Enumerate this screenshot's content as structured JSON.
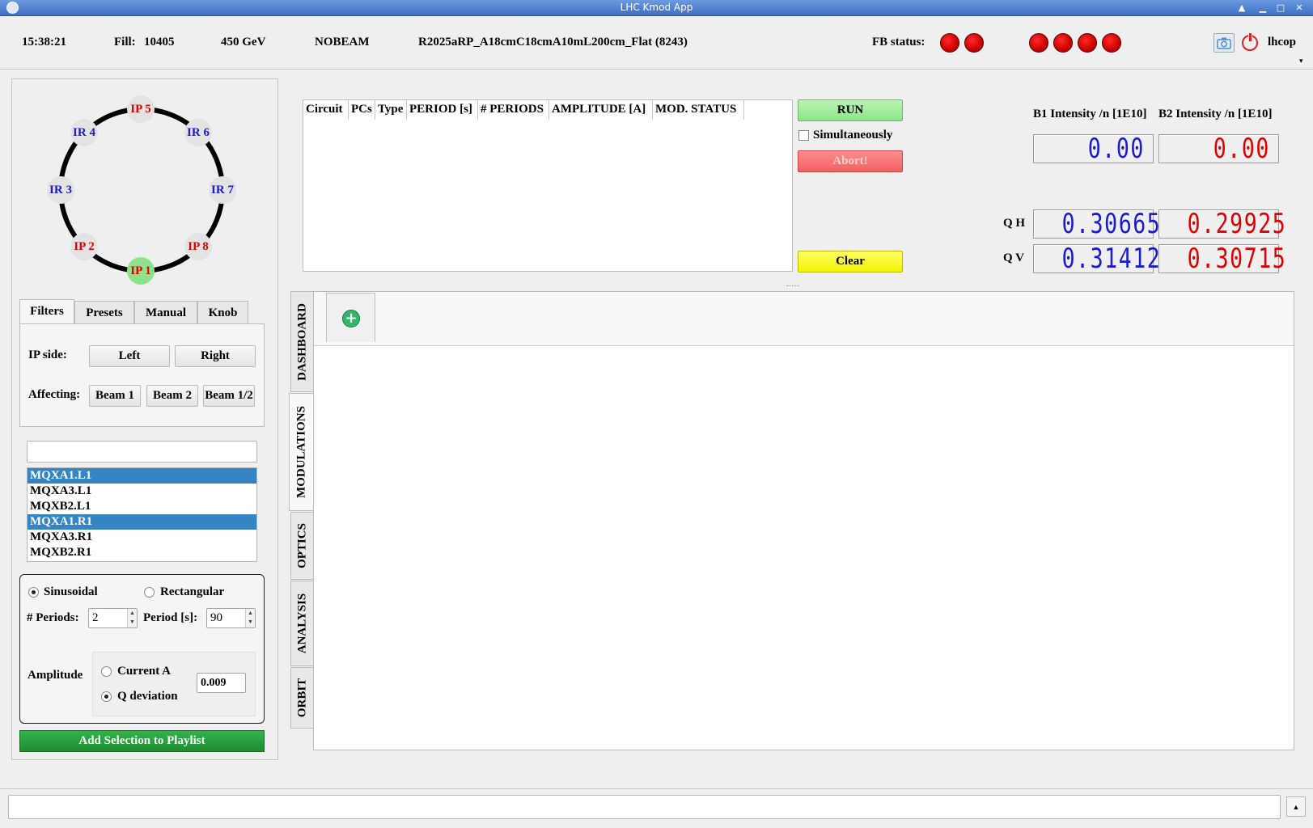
{
  "window": {
    "title": "LHC Kmod App"
  },
  "topbar": {
    "time": "15:38:21",
    "fill_label": "Fill:",
    "fill_number": "10405",
    "energy": "450 GeV",
    "beam_mode": "NOBEAM",
    "optics": "R2025aRP_A18cmC18cmA10mL200cm_Flat (8243)",
    "fb_status_label": "FB status:",
    "user": "lhcop",
    "led_color": "#e00000"
  },
  "ring": {
    "nodes": [
      {
        "label": "IP 5",
        "color": "red"
      },
      {
        "label": "IR 4",
        "color": "blue"
      },
      {
        "label": "IR 6",
        "color": "blue"
      },
      {
        "label": "IR 3",
        "color": "blue"
      },
      {
        "label": "IR 7",
        "color": "blue"
      },
      {
        "label": "IP 2",
        "color": "red"
      },
      {
        "label": "IP 8",
        "color": "red"
      },
      {
        "label": "IP 1",
        "color": "red",
        "selected": true
      }
    ]
  },
  "left_tabs": [
    "Filters",
    "Presets",
    "Manual",
    "Knob"
  ],
  "filters": {
    "ip_side_label": "IP side:",
    "left": "Left",
    "right": "Right",
    "affecting_label": "Affecting:",
    "beam1": "Beam 1",
    "beam2": "Beam 2",
    "beam12": "Beam 1/2"
  },
  "search": {
    "value": ""
  },
  "circuits": [
    {
      "name": "MQXA1.L1",
      "selected": true
    },
    {
      "name": "MQXA3.L1",
      "selected": false
    },
    {
      "name": "MQXB2.L1",
      "selected": false
    },
    {
      "name": "MQXA1.R1",
      "selected": true
    },
    {
      "name": "MQXA3.R1",
      "selected": false
    },
    {
      "name": "MQXB2.R1",
      "selected": false
    }
  ],
  "modulation": {
    "sinusoidal": "Sinusoidal",
    "rectangular": "Rectangular",
    "periods_label": "# Periods:",
    "periods_value": "2",
    "period_label": "Period [s]:",
    "period_value": "90",
    "amplitude_label": "Amplitude",
    "current_a": "Current A",
    "q_deviation": "Q deviation",
    "amplitude_value": "0.009",
    "add_button": "Add Selection to Playlist"
  },
  "playlist": {
    "columns": [
      "Circuit",
      "PCs",
      "Type",
      "PERIOD [s]",
      "# PERIODS",
      "AMPLITUDE [A]",
      "MOD. STATUS"
    ]
  },
  "controls": {
    "run": "RUN",
    "simultaneously": "Simultaneously",
    "abort": "Abort!",
    "clear": "Clear"
  },
  "readouts": {
    "b1_label": "B1 Intensity /n [1E10]",
    "b2_label": "B2 Intensity /n [1E10]",
    "b1_intensity": "0.00",
    "b2_intensity": "0.00",
    "qh_label": "Q H",
    "qv_label": "Q V",
    "qh_b1": "0.30665",
    "qh_b2": "0.29925",
    "qv_b1": "0.31412",
    "qv_b2": "0.30715",
    "b1_color": "#1a1ad0",
    "b2_color": "#e00000"
  },
  "side_tabs": [
    "DASHBOARD",
    "MODULATIONS",
    "OPTICS",
    "ANALYSIS",
    "ORBIT"
  ],
  "add_tab_icon": "plus-circle-icon"
}
